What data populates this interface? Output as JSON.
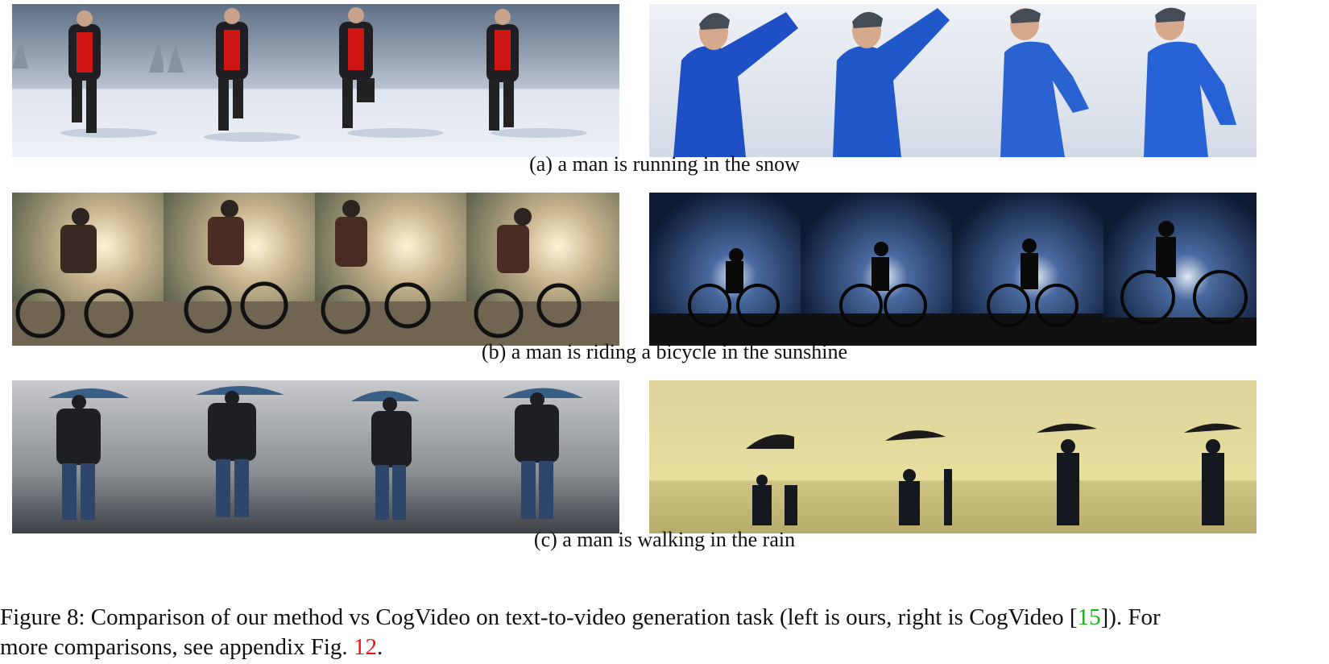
{
  "rows": [
    {
      "id": "snow",
      "caption": "(a) a man is running in the snow"
    },
    {
      "id": "bicycle",
      "caption": "(b) a man is riding a bicycle in the sunshine"
    },
    {
      "id": "rain",
      "caption": "(c) a man is walking in the rain"
    }
  ],
  "figure_caption": {
    "line1_prefix": "Figure 8: Comparison of our method vs CogVideo on text-to-video generation task (left is ours, right is CogVideo [",
    "line1_ref": "15",
    "line1_suffix": "]). For",
    "line2_prefix": "more comparisons, see appendix Fig. ",
    "line2_ref": "12",
    "line2_suffix": "."
  },
  "colors": {
    "reference_link_citation": "#17b317",
    "reference_link_figure": "#e11111"
  }
}
